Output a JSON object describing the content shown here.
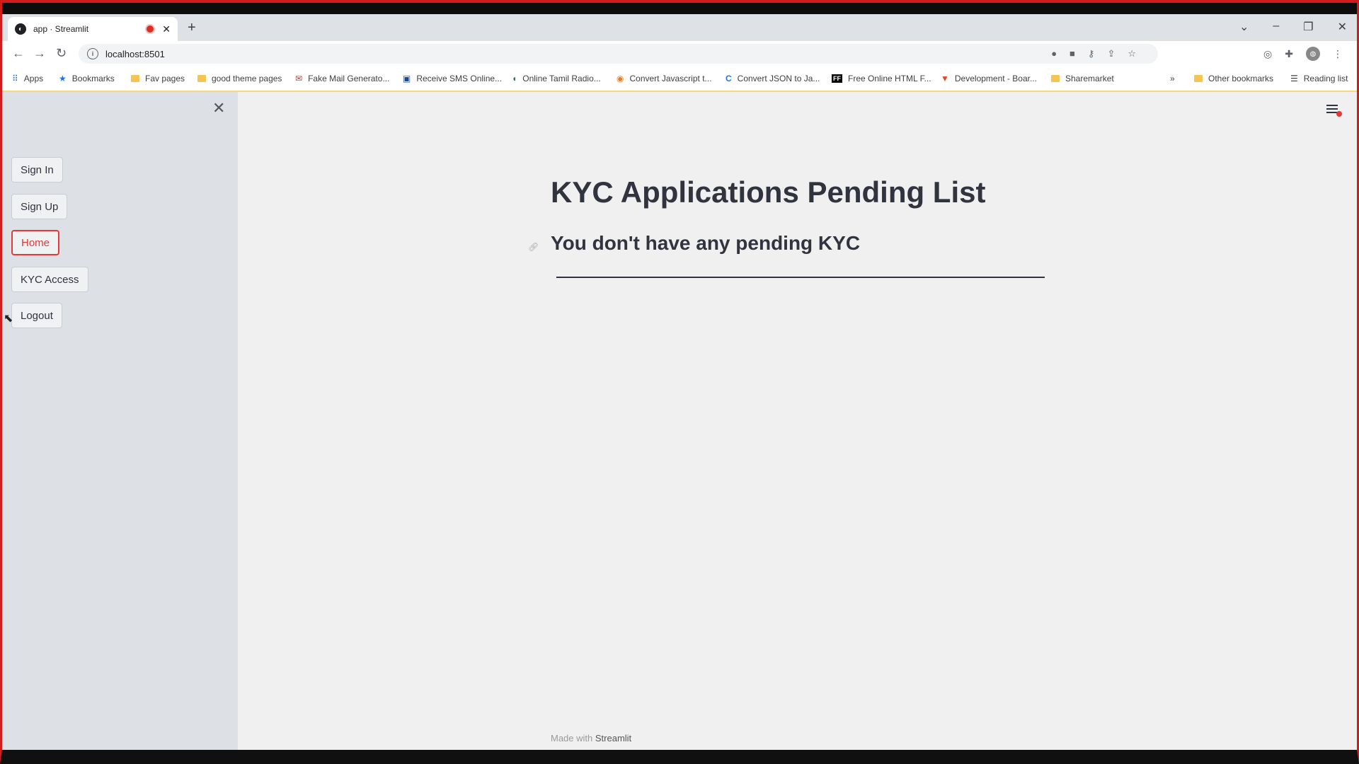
{
  "browser": {
    "tab_title": "app · Streamlit",
    "tab_close": "✕",
    "new_tab": "+",
    "url": "localhost:8501",
    "window_controls": {
      "dropdown": "⌄",
      "minimize": "–",
      "restore": "❐",
      "close": "✕"
    }
  },
  "bookmarks": [
    {
      "label": "Apps",
      "icon": "apps-grid-icon"
    },
    {
      "label": "Bookmarks",
      "icon": "star-icon"
    },
    {
      "label": "Fav pages",
      "icon": "folder-icon"
    },
    {
      "label": "good theme pages",
      "icon": "folder-icon"
    },
    {
      "label": "Fake Mail Generato...",
      "icon": "mail-icon"
    },
    {
      "label": "Receive SMS Online...",
      "icon": "sms-icon"
    },
    {
      "label": "Online Tamil Radio...",
      "icon": "radio-icon"
    },
    {
      "label": "Convert Javascript t...",
      "icon": "convert-icon"
    },
    {
      "label": "Convert JSON to Ja...",
      "icon": "json-icon"
    },
    {
      "label": "Free Online HTML F...",
      "icon": "html-icon"
    },
    {
      "label": "Development - Boar...",
      "icon": "gitlab-icon"
    },
    {
      "label": "Sharemarket",
      "icon": "folder-icon"
    }
  ],
  "bookmarks_overflow": "»",
  "other_bookmarks": "Other bookmarks",
  "reading_list": "Reading list",
  "sidebar": {
    "close": "✕",
    "buttons": [
      {
        "label": "Sign In"
      },
      {
        "label": "Sign Up"
      },
      {
        "label": "Home"
      },
      {
        "label": "KYC Access"
      },
      {
        "label": "Logout"
      }
    ]
  },
  "main": {
    "title": "KYC Applications Pending List",
    "subtitle": "You don't have any pending KYC",
    "footer_prefix": "Made with",
    "footer_brand": "Streamlit"
  },
  "colors": {
    "accent": "#e53935",
    "text": "#31333f",
    "sidebar_bg": "#dde0e5"
  }
}
